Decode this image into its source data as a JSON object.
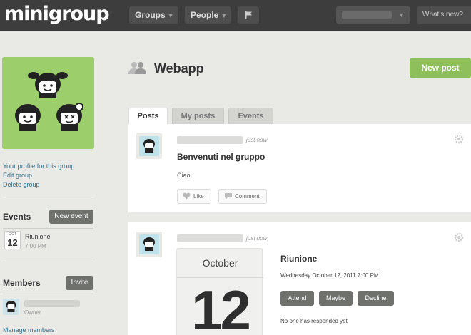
{
  "app": {
    "logo": "minigroup"
  },
  "nav": {
    "groups": "Groups",
    "people": "People",
    "whats_new": "What's new?"
  },
  "sidebar": {
    "links": [
      "Your profile for this group",
      "Edit group",
      "Delete group"
    ],
    "events_heading": "Events",
    "new_event_button": "New event",
    "event": {
      "month": "OCT",
      "day": "12",
      "title": "Riunione",
      "time": "7:00 PM"
    },
    "members_heading": "Members",
    "invite_button": "Invite",
    "member_role": "Owner",
    "manage_members": "Manage members"
  },
  "header": {
    "title": "Webapp",
    "new_post_button": "New post"
  },
  "tabs": [
    "Posts",
    "My posts",
    "Events"
  ],
  "posts": [
    {
      "timestamp": "just now",
      "title": "Benvenuti nel gruppo",
      "body": "Ciao",
      "like_label": "Like",
      "comment_label": "Comment"
    },
    {
      "timestamp": "just now",
      "calendar_month": "October",
      "calendar_day": "12",
      "event_title": "Riunione",
      "event_datetime": "Wednesday October 12, 2011 7:00 PM",
      "rsvp": [
        "Attend",
        "Maybe",
        "Decline"
      ],
      "responses": "No one has responded yet"
    }
  ],
  "colors": {
    "topbar": "#3d3d3d",
    "accent_green": "#8fbf5b",
    "button_gray": "#6f716d",
    "link": "#336f8a"
  },
  "icons": [
    "flag-icon",
    "group-people-icon",
    "gear-icon",
    "heart-icon",
    "comment-icon",
    "mascot-avatar-icon"
  ]
}
